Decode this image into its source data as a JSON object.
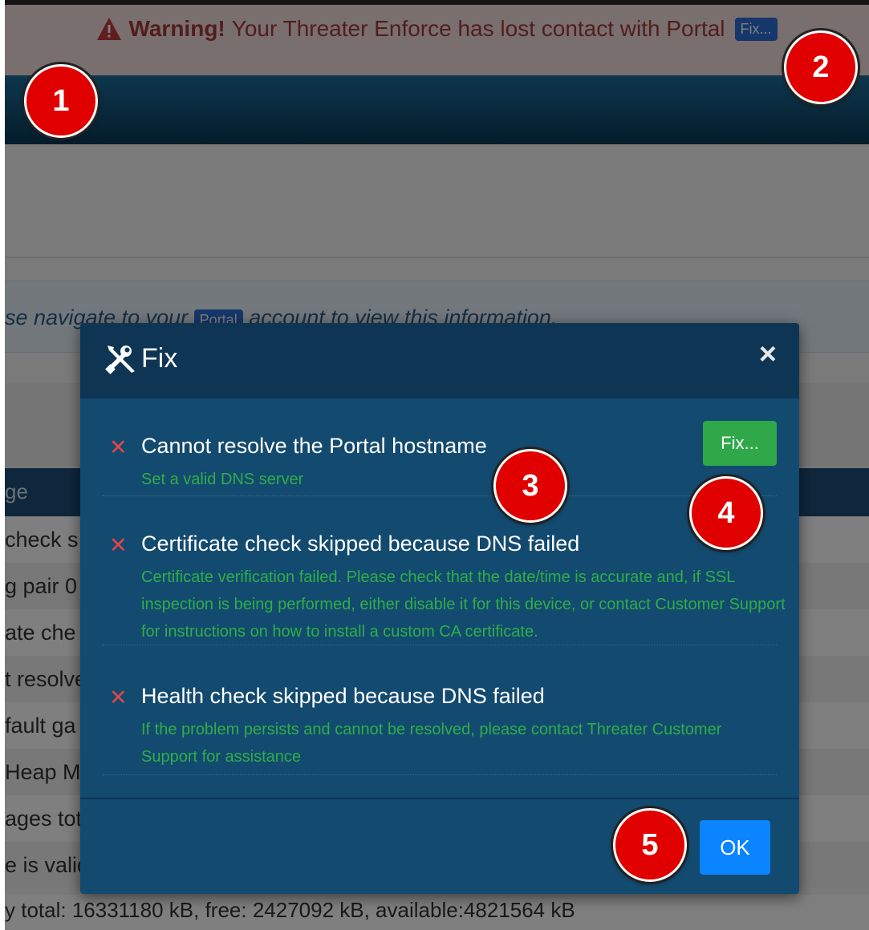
{
  "warning": {
    "strong": "Warning!",
    "message": "Your Threater Enforce has lost contact with Portal",
    "fix_label": "Fix..."
  },
  "info": {
    "text_before": "se navigate to your",
    "portal_label": "Portal",
    "text_after": "account to view this information."
  },
  "table": {
    "header_fragment": "ge",
    "rows": [
      "check s",
      "g pair 0",
      "ate che",
      "t resolve",
      "fault ga",
      "Heap M",
      "ages tot",
      "e is valid"
    ],
    "memory_line": "y total: 16331180 kB, free: 2427092 kB, available:4821564 kB"
  },
  "modal": {
    "title": "Fix",
    "close_symbol": "×",
    "issues": [
      {
        "title": "Cannot resolve the Portal hostname",
        "description": "Set a valid DNS server",
        "fix_button": "Fix..."
      },
      {
        "title": "Certificate check skipped because DNS failed",
        "description": "Certificate verification failed. Please check that the date/time is accurate and, if SSL inspection is being performed, either disable it for this device, or contact Customer Support for instructions on how to install a custom CA certificate."
      },
      {
        "title": "Health check skipped because DNS failed",
        "description": "If the problem persists and cannot be resolved, please contact Threater Customer Support for assistance"
      }
    ],
    "ok_label": "OK"
  },
  "callouts": [
    "1",
    "2",
    "3",
    "4",
    "5"
  ],
  "colors": {
    "accent_red": "#e00000",
    "success_green": "#2fa84a",
    "primary_blue": "#0a84ff"
  }
}
